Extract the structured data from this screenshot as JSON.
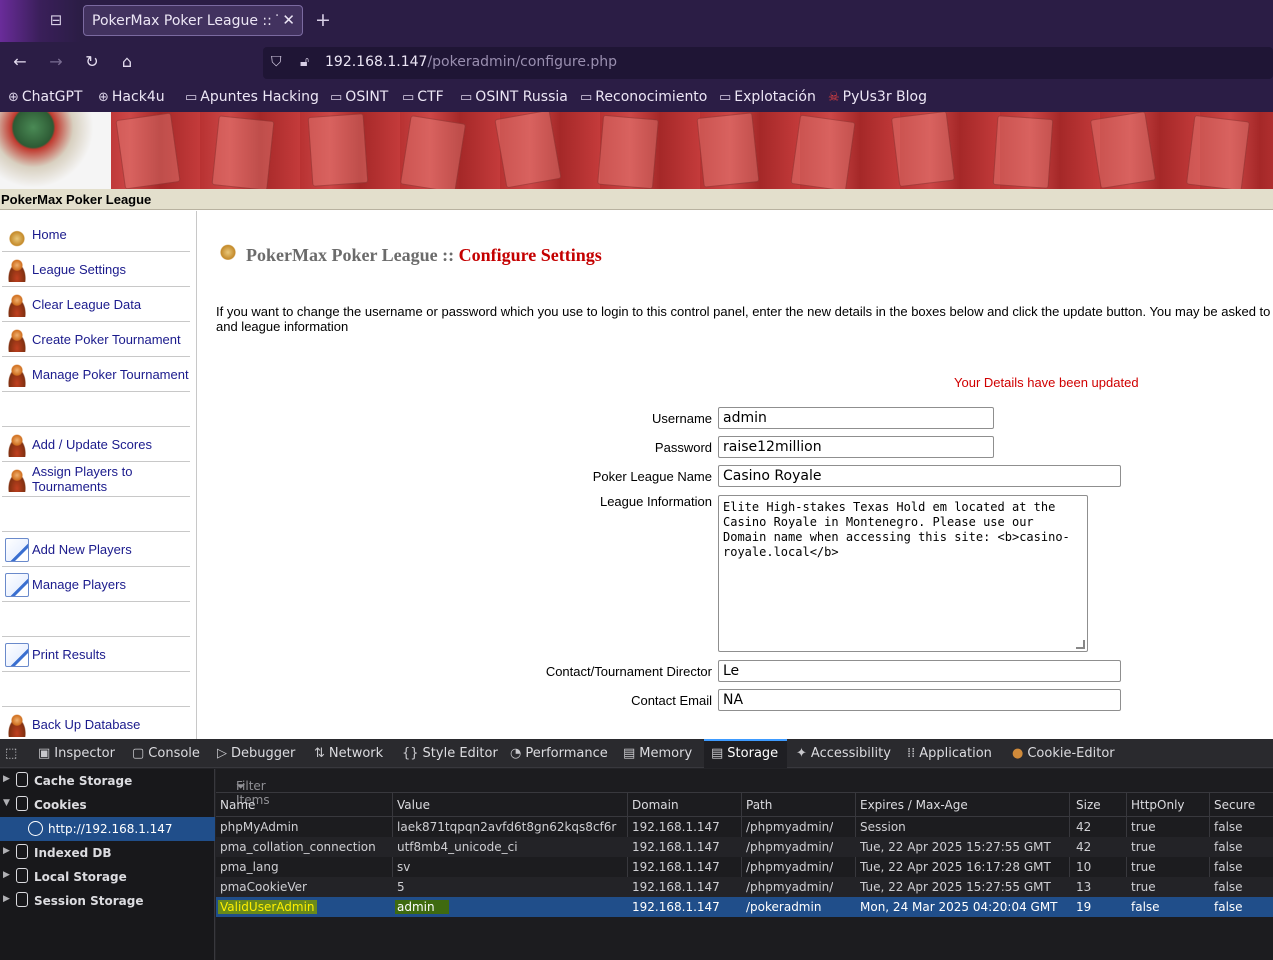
{
  "browser": {
    "tab_title": "PokerMax Poker League :: Th",
    "url_host": "192.168.1.147",
    "url_path": "/pokeradmin/configure.php",
    "bookmarks": [
      "ChatGPT",
      "Hack4u",
      "Apuntes Hacking",
      "OSINT",
      "CTF",
      "OSINT Russia",
      "Reconocimiento",
      "Explotación",
      "PyUs3r Blog"
    ]
  },
  "site": {
    "name": "PokerMax Poker League",
    "sidebar": [
      "Home",
      "League Settings",
      "Clear League Data",
      "Create Poker Tournament",
      "Manage Poker Tournament",
      "Add / Update Scores",
      "Assign Players to Tournaments",
      "Add New Players",
      "Manage Players",
      "Print Results",
      "Back Up Database"
    ],
    "title_prefix": "PokerMax Poker League :: ",
    "title_highlight": "Configure Settings",
    "intro": "If you want to change the username or password which you use to login to this control panel, enter the new details in the boxes below and click the update button. You may be asked to and league information",
    "status_message": "Your Details have been updated",
    "form": {
      "username_label": "Username",
      "username_value": "admin",
      "password_label": "Password",
      "password_value": "raise12million",
      "league_name_label": "Poker League Name",
      "league_name_value": "Casino Royale",
      "league_info_label": "League Information",
      "league_info_value": "Elite High-stakes Texas Hold em located at the Casino Royale in Montenegro. Please use our Domain name when accessing this site: <b>casino-royale.local</b>",
      "director_label": "Contact/Tournament Director",
      "director_value": "Le",
      "email_label": "Contact Email",
      "email_value": "NA"
    }
  },
  "devtools": {
    "tabs": [
      "Inspector",
      "Console",
      "Debugger",
      "Network",
      "Style Editor",
      "Performance",
      "Memory",
      "Storage",
      "Accessibility",
      "Application",
      "Cookie-Editor"
    ],
    "active_tab": "Storage",
    "tree": [
      "Cache Storage",
      "Cookies",
      "http://192.168.1.147",
      "Indexed DB",
      "Local Storage",
      "Session Storage"
    ],
    "filter_placeholder": "Filter Items",
    "columns": [
      "Name",
      "Value",
      "Domain",
      "Path",
      "Expires / Max-Age",
      "Size",
      "HttpOnly",
      "Secure"
    ],
    "rows": [
      [
        "phpMyAdmin",
        "laek871tqpqn2avfd6t8gn62kqs8cf6r",
        "192.168.1.147",
        "/phpmyadmin/",
        "Session",
        "42",
        "true",
        "false"
      ],
      [
        "pma_collation_connection",
        "utf8mb4_unicode_ci",
        "192.168.1.147",
        "/phpmyadmin/",
        "Tue, 22 Apr 2025 15:27:55 GMT",
        "42",
        "true",
        "false"
      ],
      [
        "pma_lang",
        "sv",
        "192.168.1.147",
        "/phpmyadmin/",
        "Tue, 22 Apr 2025 16:17:28 GMT",
        "10",
        "true",
        "false"
      ],
      [
        "pmaCookieVer",
        "5",
        "192.168.1.147",
        "/phpmyadmin/",
        "Tue, 22 Apr 2025 15:27:55 GMT",
        "13",
        "true",
        "false"
      ],
      [
        "ValidUserAdmin",
        "admin",
        "192.168.1.147",
        "/pokeradmin",
        "Mon, 24 Mar 2025 04:20:04 GMT",
        "19",
        "false",
        "false"
      ]
    ]
  }
}
